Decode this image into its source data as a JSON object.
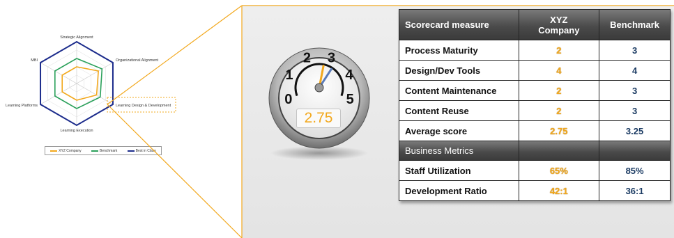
{
  "radar": {
    "axes": [
      "Strategic Alignment",
      "Organizational Alignment",
      "Learning Design & Development",
      "Learning Execution",
      "Learning Platforms",
      "MBI"
    ],
    "legend": [
      "XYZ Company",
      "Benchmark",
      "Best in Class"
    ]
  },
  "chart_data": {
    "type": "radar",
    "axes": [
      "Strategic Alignment",
      "Organizational Alignment",
      "Learning Design & Development",
      "Learning Execution",
      "Learning Platforms",
      "MBI"
    ],
    "series": [
      {
        "name": "XYZ Company",
        "values": [
          2,
          3,
          2.75,
          2,
          2,
          2
        ]
      },
      {
        "name": "Benchmark",
        "values": [
          3,
          3.5,
          3.25,
          3,
          3,
          3
        ]
      },
      {
        "name": "Best in Class",
        "values": [
          5,
          5,
          5,
          5,
          5,
          5
        ]
      }
    ],
    "range": [
      0,
      5
    ],
    "legend_position": "bottom"
  },
  "colors": {
    "xyz": "#f2a81d",
    "benchmark": "#2aa05a",
    "best_in_class": "#1c2c8c",
    "connector": "#f2a81d"
  },
  "gauge": {
    "ticks": [
      "0",
      "1",
      "2",
      "3",
      "4",
      "5"
    ],
    "value": "2.75",
    "needle_value": 2.75,
    "benchmark_value": 3.25
  },
  "table": {
    "headers": {
      "measure": "Scorecard measure",
      "xyz": "XYZ Company",
      "benchmark": "Benchmark"
    },
    "rows": [
      {
        "label": "Process Maturity",
        "xyz": "2",
        "benchmark": "3"
      },
      {
        "label": "Design/Dev Tools",
        "xyz": "4",
        "benchmark": "4"
      },
      {
        "label": "Content Maintenance",
        "xyz": "2",
        "benchmark": "3"
      },
      {
        "label": "Content Reuse",
        "xyz": "2",
        "benchmark": "3"
      },
      {
        "label": "Average score",
        "xyz": "2.75",
        "benchmark": "3.25"
      }
    ],
    "section": "Business Metrics",
    "metrics": [
      {
        "label": "Staff Utilization",
        "xyz": "65%",
        "benchmark": "85%"
      },
      {
        "label": "Development Ratio",
        "xyz": "42:1",
        "benchmark": "36:1"
      }
    ]
  }
}
